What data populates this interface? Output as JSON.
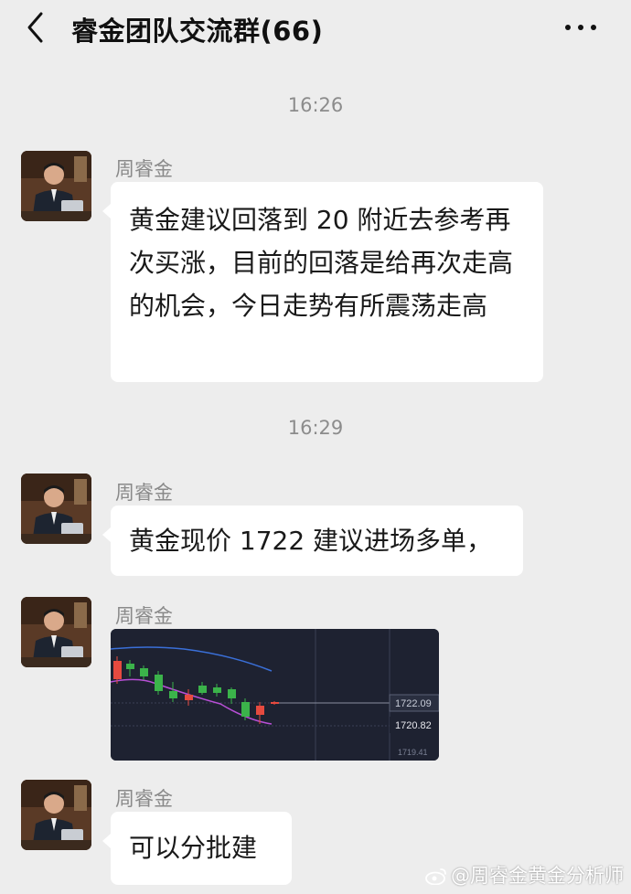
{
  "header": {
    "title": "睿金团队交流群(66)"
  },
  "messages": [
    {
      "time": "16:26",
      "sender": "周睿金",
      "text": "黄金建议回落到 20 附近去参考再次买涨，目前的回落是给再次走高的机会，今日走势有所震荡走高"
    },
    {
      "time": "16:29",
      "sender": "周睿金",
      "text": "黄金现价 1722 建议进场多单，"
    },
    {
      "sender": "周睿金",
      "type": "image"
    },
    {
      "sender": "周睿金",
      "text": "可以分批建"
    }
  ],
  "chart_image": {
    "price_labels": [
      "1722.09",
      "1720.82",
      "1719.41"
    ],
    "up_color": "#e64a3f",
    "down_color": "#3bb34a",
    "line_color_upper": "#3a6fd8",
    "line_color_lower": "#b84fd6"
  },
  "watermark": {
    "text": "@周睿金黄金分析师"
  }
}
